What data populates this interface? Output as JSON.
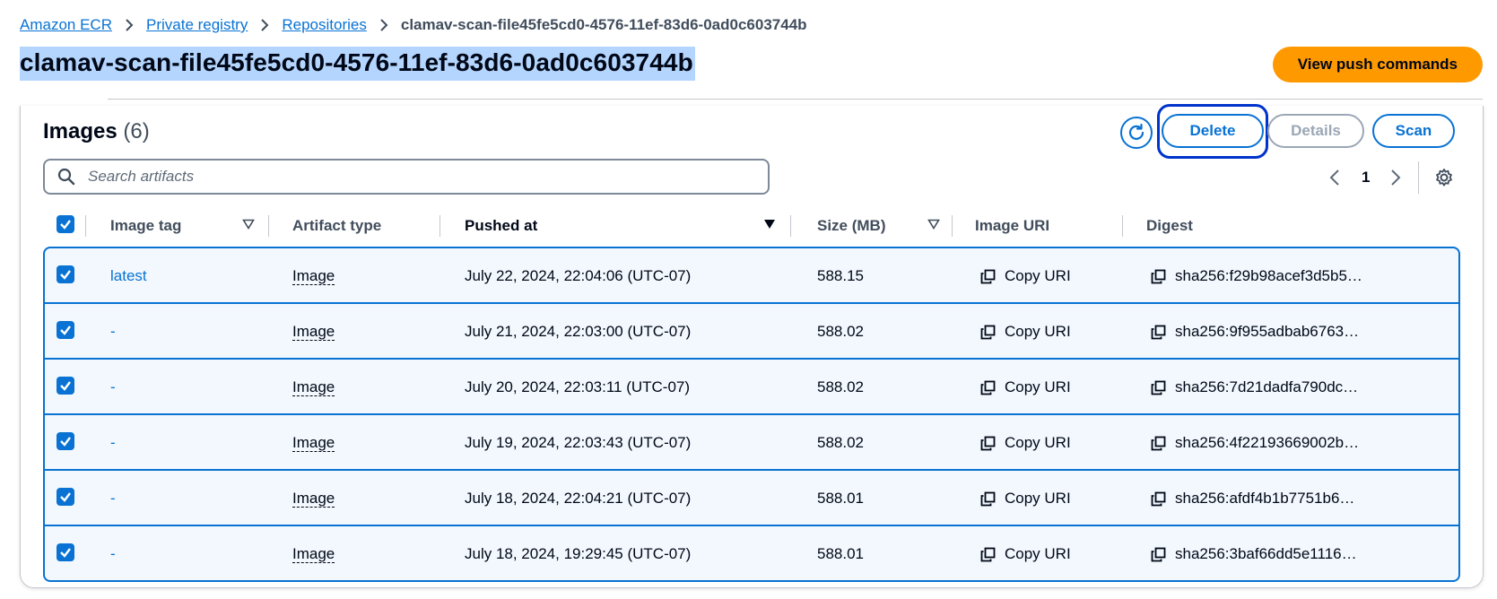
{
  "breadcrumb": {
    "items": [
      "Amazon ECR",
      "Private registry",
      "Repositories"
    ],
    "current": "clamav-scan-file45fe5cd0-4576-11ef-83d6-0ad0c603744b"
  },
  "page": {
    "title": "clamav-scan-file45fe5cd0-4576-11ef-83d6-0ad0c603744b",
    "push_commands_label": "View push commands"
  },
  "images": {
    "title": "Images",
    "count": "(6)",
    "delete_label": "Delete",
    "details_label": "Details",
    "scan_label": "Scan",
    "search_placeholder": "Search artifacts",
    "page_number": "1"
  },
  "table": {
    "columns": [
      "Image tag",
      "Artifact type",
      "Pushed at",
      "Size (MB)",
      "Image URI",
      "Digest"
    ],
    "rows": [
      {
        "tag": "latest",
        "artifact": "Image",
        "pushed": "July 22, 2024, 22:04:06 (UTC-07)",
        "size": "588.15",
        "uri": "Copy URI",
        "digest": "sha256:f29b98acef3d5b5…"
      },
      {
        "tag": "-",
        "artifact": "Image",
        "pushed": "July 21, 2024, 22:03:00 (UTC-07)",
        "size": "588.02",
        "uri": "Copy URI",
        "digest": "sha256:9f955adbab6763…"
      },
      {
        "tag": "-",
        "artifact": "Image",
        "pushed": "July 20, 2024, 22:03:11 (UTC-07)",
        "size": "588.02",
        "uri": "Copy URI",
        "digest": "sha256:7d21dadfa790dc…"
      },
      {
        "tag": "-",
        "artifact": "Image",
        "pushed": "July 19, 2024, 22:03:43 (UTC-07)",
        "size": "588.02",
        "uri": "Copy URI",
        "digest": "sha256:4f22193669002b…"
      },
      {
        "tag": "-",
        "artifact": "Image",
        "pushed": "July 18, 2024, 22:04:21 (UTC-07)",
        "size": "588.01",
        "uri": "Copy URI",
        "digest": "sha256:afdf4b1b7751b6…"
      },
      {
        "tag": "-",
        "artifact": "Image",
        "pushed": "July 18, 2024, 19:29:45 (UTC-07)",
        "size": "588.01",
        "uri": "Copy URI",
        "digest": "sha256:3baf66dd5e1116…"
      }
    ]
  },
  "colors": {
    "link": "#0972d3",
    "primary_button": "#ff9900",
    "selection_highlight": "#b4d5fe",
    "selected_row_bg": "#f2f8fd",
    "focus_ring": "#0033cc"
  }
}
